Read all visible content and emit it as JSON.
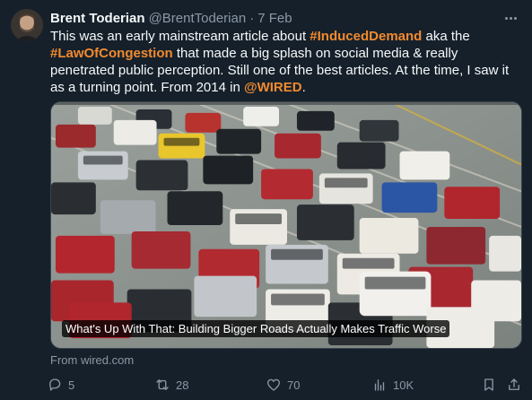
{
  "tweet": {
    "author_name": "Brent Toderian",
    "handle": "@BrentToderian",
    "separator": "·",
    "time": "7 Feb",
    "text": {
      "line1_a": "This was an early mainstream article about ",
      "tag1": "#InducedDemand",
      "line1_b": " aka the",
      "tag2": "#LawOfCongestion",
      "line2": " that made a big splash on social media & really penetrated public perception. Still one of the best articles. At the time, I saw it as a turning point. From 2014 in ",
      "mention": "@WIRED",
      "end": "."
    },
    "media": {
      "caption": "What's Up With That: Building Bigger Roads Actually Makes Traffic Worse"
    },
    "source": "From wired.com",
    "actions": {
      "replies": "5",
      "reposts": "28",
      "likes": "70",
      "views": "10K"
    }
  },
  "colors": {
    "background": "#15202b",
    "accent": "#f28a2e",
    "muted": "#8b98a5"
  },
  "icons": [
    "more-icon",
    "reply-icon",
    "repost-icon",
    "like-icon",
    "views-icon",
    "bookmark-icon",
    "share-icon"
  ]
}
